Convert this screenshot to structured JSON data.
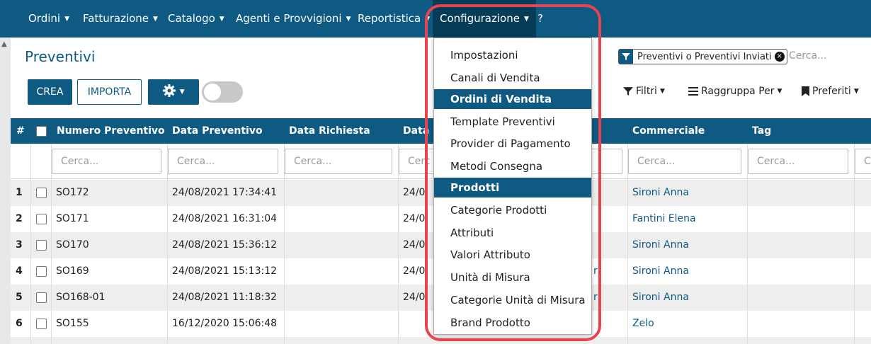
{
  "topnav": {
    "items": [
      {
        "label": "Ordini",
        "caret": "▼"
      },
      {
        "label": "Fatturazione",
        "caret": "▼"
      },
      {
        "label": "Catalogo",
        "caret": "▼"
      },
      {
        "label": "Agenti e Provvigioni",
        "caret": "▼"
      },
      {
        "label": "Reportistica",
        "caret": "▼"
      },
      {
        "label": "Configurazione",
        "caret": "▼"
      },
      {
        "label": "?"
      }
    ],
    "active_item": "Configurazione"
  },
  "page": {
    "title": "Preventivi",
    "create_label": "CREA",
    "import_label": "IMPORTA",
    "settings_icon": "gear-icon",
    "toggle_state": "off"
  },
  "search": {
    "facet_icon": "filter-icon",
    "facet_label": "Preventivi o Preventivi Inviati",
    "facet_remove": "×",
    "placeholder": "Cerca..."
  },
  "controls": {
    "filters_label": "Filtri",
    "group_by_label": "Raggruppa Per",
    "favorites_label": "Preferiti"
  },
  "table": {
    "headers": {
      "num": "#",
      "number": "Numero Preventivo",
      "date": "Data Preventivo",
      "requested": "Data Richiesta",
      "partial": "Data I",
      "salesperson": "Commerciale",
      "tag": "Tag"
    },
    "filter_placeholders": {
      "full": "Cerca...",
      "partial_start": "Cerc",
      "partial_end": "Ce"
    },
    "rows": [
      {
        "index": "1",
        "number": "SO172",
        "date": "24/08/2021 17:34:41",
        "partial": "24/0",
        "hidden_tail": "",
        "salesperson": "Sironi Anna"
      },
      {
        "index": "2",
        "number": "SO171",
        "date": "24/08/2021 16:31:04",
        "partial": "24/0",
        "hidden_tail": "",
        "salesperson": "Fantini Elena"
      },
      {
        "index": "3",
        "number": "SO170",
        "date": "24/08/2021 15:36:12",
        "partial": "24/0",
        "hidden_tail": "",
        "salesperson": "Sironi Anna"
      },
      {
        "index": "4",
        "number": "SO169",
        "date": "24/08/2021 15:13:12",
        "partial": "24/0",
        "hidden_tail": "rl",
        "salesperson": "Sironi Anna"
      },
      {
        "index": "5",
        "number": "SO168-01",
        "date": "24/08/2021 11:18:32",
        "partial": "24/0",
        "hidden_tail": "rl",
        "salesperson": "Sironi Anna"
      },
      {
        "index": "6",
        "number": "SO155",
        "date": "16/12/2020 15:06:48",
        "partial": "",
        "hidden_tail": "",
        "salesperson": "Zelo"
      }
    ]
  },
  "dropdown": {
    "items": [
      {
        "label": "Impostazioni",
        "header": false
      },
      {
        "label": "Canali di Vendita",
        "header": false
      },
      {
        "label": "Ordini di Vendita",
        "header": true
      },
      {
        "label": "Template Preventivi",
        "header": false
      },
      {
        "label": "Provider di Pagamento",
        "header": false
      },
      {
        "label": "Metodi Consegna",
        "header": false
      },
      {
        "label": "Prodotti",
        "header": true
      },
      {
        "label": "Categorie Prodotti",
        "header": false
      },
      {
        "label": "Attributi",
        "header": false
      },
      {
        "label": "Valori Attributo",
        "header": false
      },
      {
        "label": "Unità di Misura",
        "header": false
      },
      {
        "label": "Categorie Unità di Misura",
        "header": false
      },
      {
        "label": "Brand Prodotto",
        "header": false
      }
    ]
  },
  "colors": {
    "brand": "#0e5a82",
    "brand_dark": "#063c57",
    "highlight": "#e8434f"
  }
}
